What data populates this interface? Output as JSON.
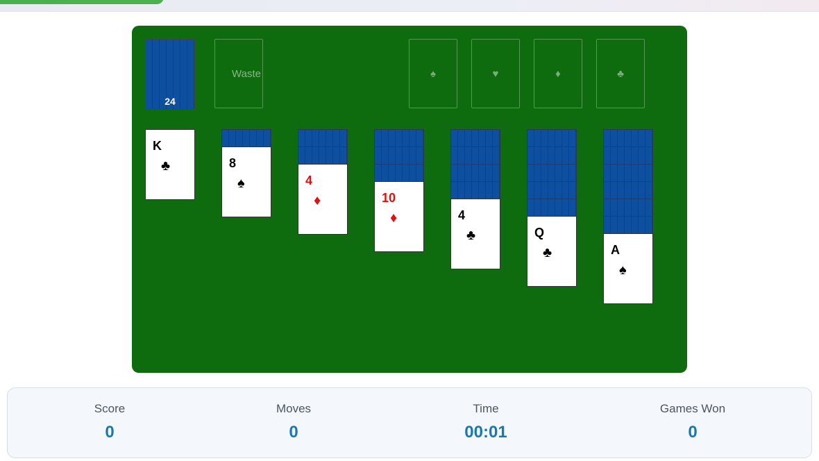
{
  "stock": {
    "count": "24"
  },
  "waste": {
    "label": "Waste"
  },
  "foundations": [
    {
      "suit": "♠",
      "icon": "spade-icon"
    },
    {
      "suit": "♥",
      "icon": "heart-icon"
    },
    {
      "suit": "♦",
      "icon": "diamond-icon"
    },
    {
      "suit": "♣",
      "icon": "club-icon"
    }
  ],
  "tableau": [
    {
      "hidden_count": 0,
      "top": {
        "rank": "K",
        "suit": "♣",
        "color": "black"
      }
    },
    {
      "hidden_count": 1,
      "top": {
        "rank": "8",
        "suit": "♠",
        "color": "black"
      }
    },
    {
      "hidden_count": 2,
      "top": {
        "rank": "4",
        "suit": "♦",
        "color": "red"
      }
    },
    {
      "hidden_count": 3,
      "top": {
        "rank": "10",
        "suit": "♦",
        "color": "red"
      }
    },
    {
      "hidden_count": 4,
      "top": {
        "rank": "4",
        "suit": "♣",
        "color": "black"
      }
    },
    {
      "hidden_count": 5,
      "top": {
        "rank": "Q",
        "suit": "♣",
        "color": "black"
      }
    },
    {
      "hidden_count": 6,
      "top": {
        "rank": "A",
        "suit": "♠",
        "color": "black"
      }
    }
  ],
  "stats": {
    "score_label": "Score",
    "score_value": "0",
    "moves_label": "Moves",
    "moves_value": "0",
    "time_label": "Time",
    "time_value": "00:01",
    "won_label": "Games Won",
    "won_value": "0"
  },
  "colors": {
    "table": "#0e6b0e",
    "card_back": "#0e4fa0",
    "red_suit": "#e01010",
    "stat_value": "#1a78b0",
    "top_pill": "#4caf50"
  }
}
